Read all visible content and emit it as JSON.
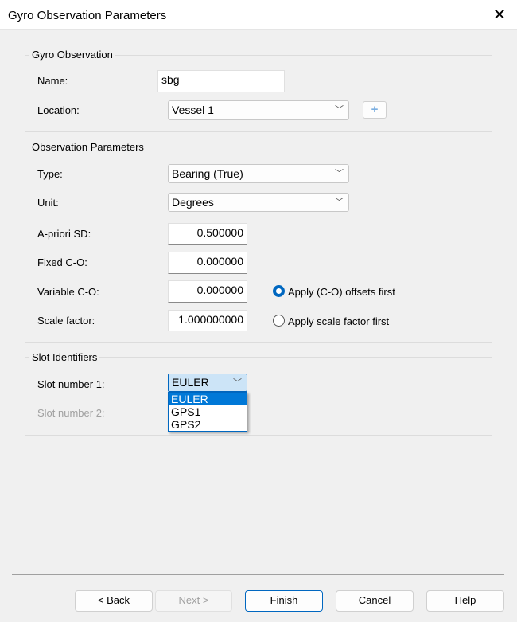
{
  "window": {
    "title": "Gyro Observation Parameters",
    "close_icon": "close-icon"
  },
  "gyro": {
    "legend": "Gyro Observation",
    "name_label": "Name:",
    "name_value": "sbg",
    "location_label": "Location:",
    "location_value": "Vessel 1",
    "add_icon": "plus-icon"
  },
  "obs": {
    "legend": "Observation Parameters",
    "type_label": "Type:",
    "type_value": "Bearing (True)",
    "unit_label": "Unit:",
    "unit_value": "Degrees",
    "apriori_label": "A-priori SD:",
    "apriori_value": "0.500000",
    "fixed_label": "Fixed C-O:",
    "fixed_value": "0.000000",
    "variable_label": "Variable C-O:",
    "variable_value": "0.000000",
    "scale_label": "Scale factor:",
    "scale_value": "1.000000000",
    "radio1": "Apply (C-O) offsets first",
    "radio2": "Apply scale factor first",
    "selected_radio": 1
  },
  "slots": {
    "legend": "Slot Identifiers",
    "slot1_label": "Slot number 1:",
    "slot1_value": "EULER",
    "slot2_label": "Slot number 2:",
    "options": [
      "EULER",
      "GPS1",
      "GPS2"
    ]
  },
  "buttons": {
    "back": "< Back",
    "next": "Next >",
    "finish": "Finish",
    "cancel": "Cancel",
    "help": "Help"
  }
}
